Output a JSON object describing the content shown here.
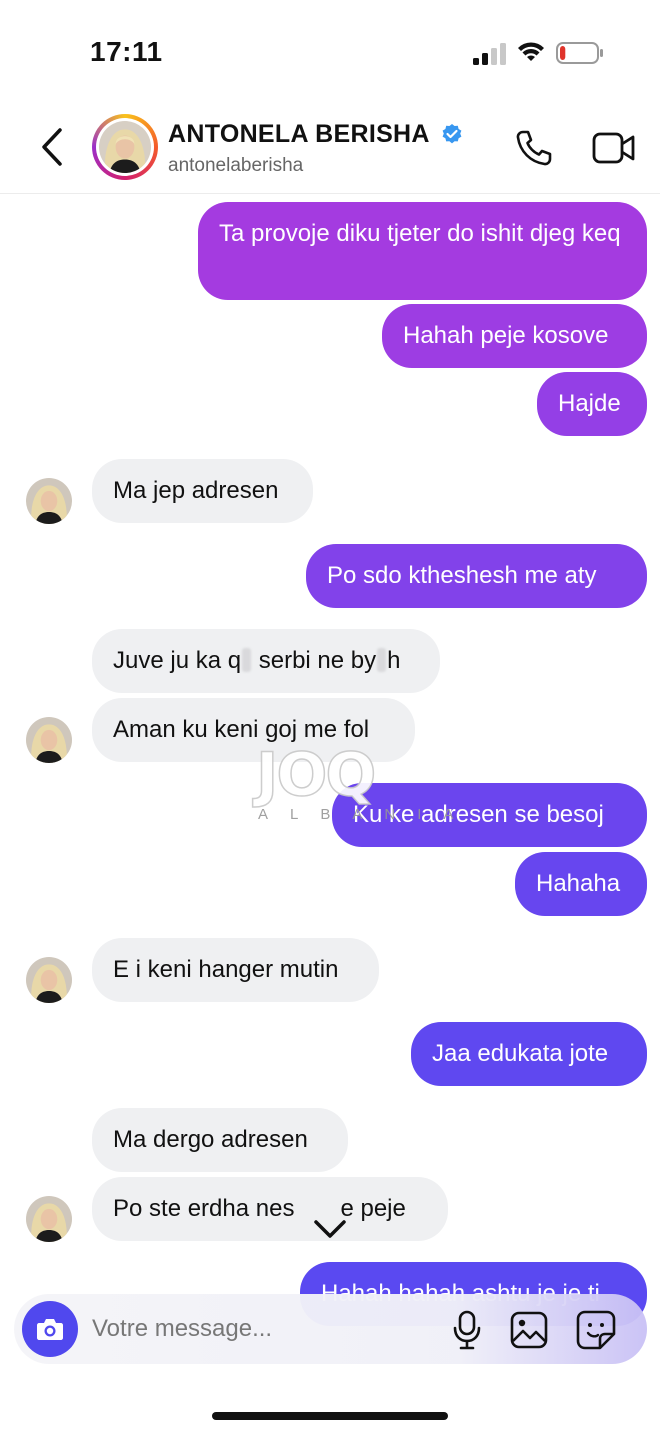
{
  "status_bar": {
    "time": "17:11",
    "battery_level": 0.15,
    "battery_color": "#e0342b"
  },
  "header": {
    "name": "ANTONELA BERISHA",
    "handle": "antonelaberisha",
    "verified": true,
    "verified_color": "#3897f0",
    "icons": [
      "chevron-left-icon",
      "phone-icon",
      "video-camera-icon"
    ]
  },
  "messages": [
    {
      "side": "sent",
      "text": "Ta provoje diku tjeter do ishit djeg keq"
    },
    {
      "side": "sent",
      "text": "Hahah peje kosove"
    },
    {
      "side": "sent",
      "text": "Hajde"
    },
    {
      "side": "received",
      "text": "Ma jep adresen"
    },
    {
      "side": "sent",
      "text": "Po sdo ktheshesh me aty"
    },
    {
      "side": "received",
      "parts": [
        "Juve ju ka q",
        " serbi ne by",
        "h"
      ]
    },
    {
      "side": "received",
      "text": "Aman ku keni goj me fol"
    },
    {
      "side": "sent",
      "text": "Ku ke adresen se besoj"
    },
    {
      "side": "sent",
      "text": "Hahaha"
    },
    {
      "side": "received",
      "text": "E i keni hanger mutin"
    },
    {
      "side": "sent",
      "text": "Jaa edukata jote"
    },
    {
      "side": "received",
      "text": "Ma dergo adresen"
    },
    {
      "side": "received",
      "parts": [
        "Po ste erdha nes",
        "e peje"
      ]
    },
    {
      "side": "sent",
      "text": "Hahah hahah ashtu je je ti"
    }
  ],
  "watermark": {
    "logo": "JOQ",
    "sub": "ALBANIA"
  },
  "composer": {
    "placeholder": "Votre message...",
    "icons": [
      "camera-icon",
      "microphone-icon",
      "gallery-icon",
      "sticker-icon"
    ]
  },
  "colors": {
    "sent_gradient_top": "#a43be0",
    "sent_gradient_bottom": "#5a49f1",
    "received_bubble": "#eff0f2"
  }
}
